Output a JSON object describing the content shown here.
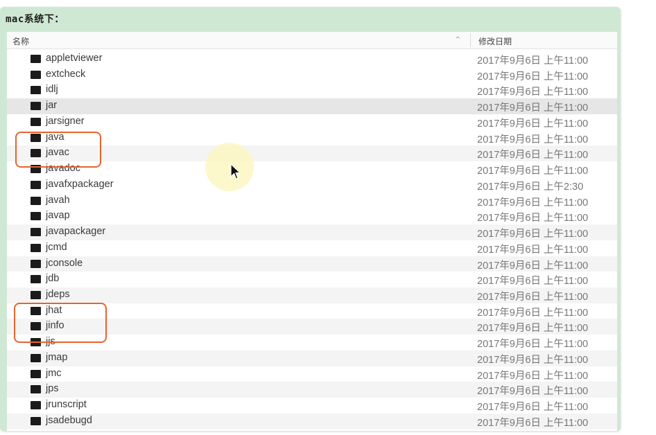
{
  "panel": {
    "title": "mac系统下："
  },
  "columns": {
    "name": "名称",
    "sort_indicator": "^",
    "date": "修改日期"
  },
  "files": [
    {
      "name": "appletviewer",
      "date": "2017年9月6日 上午11:00"
    },
    {
      "name": "extcheck",
      "date": "2017年9月6日 上午11:00"
    },
    {
      "name": "idlj",
      "date": "2017年9月6日 上午11:00"
    },
    {
      "name": "jar",
      "date": "2017年9月6日 上午11:00"
    },
    {
      "name": "jarsigner",
      "date": "2017年9月6日 上午11:00"
    },
    {
      "name": "java",
      "date": "2017年9月6日 上午11:00"
    },
    {
      "name": "javac",
      "date": "2017年9月6日 上午11:00"
    },
    {
      "name": "javadoc",
      "date": "2017年9月6日 上午11:00"
    },
    {
      "name": "javafxpackager",
      "date": "2017年9月6日 上午2:30"
    },
    {
      "name": "javah",
      "date": "2017年9月6日 上午11:00"
    },
    {
      "name": "javap",
      "date": "2017年9月6日 上午11:00"
    },
    {
      "name": "javapackager",
      "date": "2017年9月6日 上午11:00"
    },
    {
      "name": "jcmd",
      "date": "2017年9月6日 上午11:00"
    },
    {
      "name": "jconsole",
      "date": "2017年9月6日 上午11:00"
    },
    {
      "name": "jdb",
      "date": "2017年9月6日 上午11:00"
    },
    {
      "name": "jdeps",
      "date": "2017年9月6日 上午11:00"
    },
    {
      "name": "jhat",
      "date": "2017年9月6日 上午11:00"
    },
    {
      "name": "jinfo",
      "date": "2017年9月6日 上午11:00"
    },
    {
      "name": "jjs",
      "date": "2017年9月6日 上午11:00"
    },
    {
      "name": "jmap",
      "date": "2017年9月6日 上午11:00"
    },
    {
      "name": "jmc",
      "date": "2017年9月6日 上午11:00"
    },
    {
      "name": "jps",
      "date": "2017年9月6日 上午11:00"
    },
    {
      "name": "jrunscript",
      "date": "2017年9月6日 上午11:00"
    },
    {
      "name": "jsadebugd",
      "date": "2017年9月6日 上午11:00"
    }
  ],
  "colors": {
    "panel_bg": "#cfe8d3",
    "highlight_border": "#e8622f",
    "icon": "#1b1b1b"
  }
}
